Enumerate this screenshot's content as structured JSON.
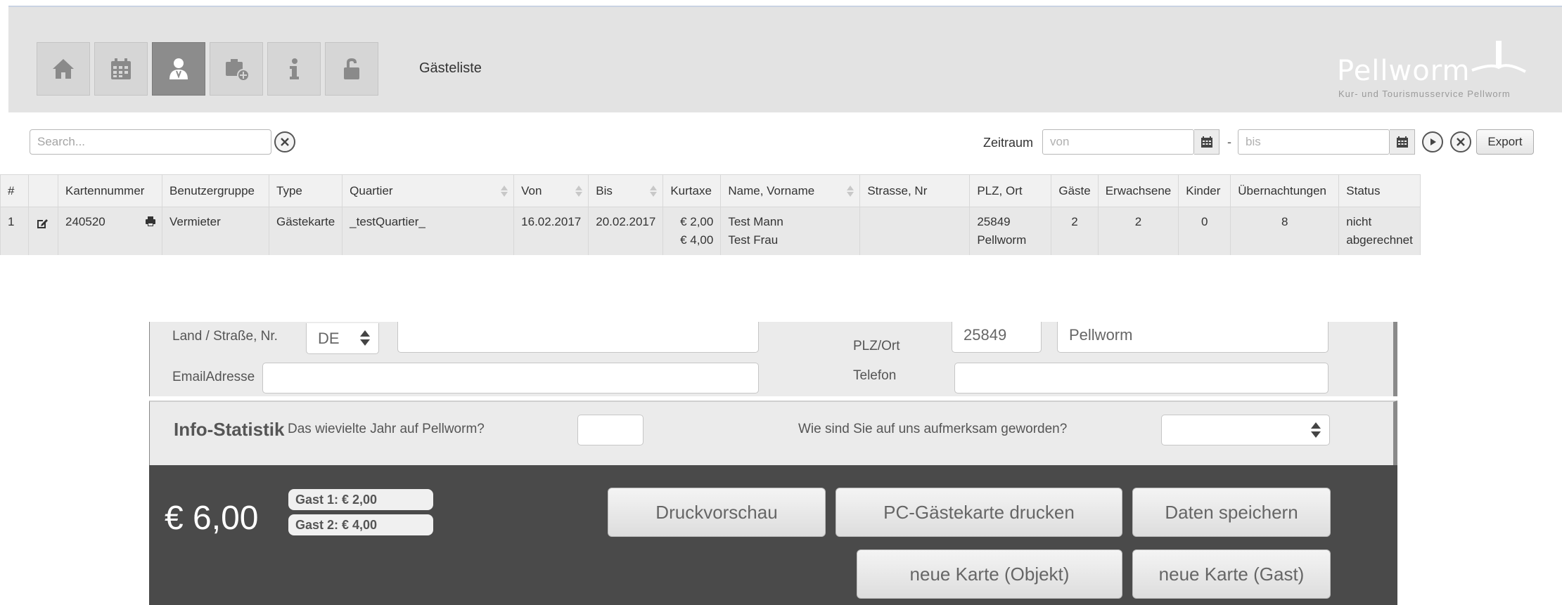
{
  "header": {
    "page_title": "Gästeliste",
    "logo_name": "Pellworm",
    "logo_subtitle": "Kur- und Tourismusservice Pellworm",
    "nav": [
      {
        "icon": "home-icon",
        "active": false
      },
      {
        "icon": "calendar-icon",
        "active": false
      },
      {
        "icon": "guest-user-icon",
        "active": true
      },
      {
        "icon": "add-card-icon",
        "active": false
      },
      {
        "icon": "info-icon",
        "active": false
      },
      {
        "icon": "unlock-icon",
        "active": false
      }
    ]
  },
  "toolbar": {
    "search_placeholder": "Search...",
    "zeitraum_label": "Zeitraum",
    "von_placeholder": "von",
    "date_separator": "-",
    "bis_placeholder": "bis",
    "export_label": "Export"
  },
  "table": {
    "columns": [
      "#",
      "",
      "Kartennummer",
      "Benutzergruppe",
      "Type",
      "Quartier",
      "Von",
      "Bis",
      "Kurtaxe",
      "Name, Vorname",
      "Strasse, Nr",
      "PLZ, Ort",
      "Gäste",
      "Erwachsene",
      "Kinder",
      "Übernachtungen",
      "Status"
    ],
    "rows": [
      {
        "index": "1",
        "kartennummer": "240520",
        "benutzergruppe": "Vermieter",
        "type": "Gästekarte",
        "quartier": "_testQuartier_",
        "von": "16.02.2017",
        "bis": "20.02.2017",
        "kurtaxe_1": "€ 2,00",
        "kurtaxe_2": "€ 4,00",
        "name_1": "Test Mann",
        "name_2": "Test Frau",
        "strasse": "",
        "plz": "25849",
        "ort": "Pellworm",
        "gaeste": "2",
        "erwachsene": "2",
        "kinder": "0",
        "uebernachtungen": "8",
        "status_1": "nicht",
        "status_2": "abgerechnet"
      }
    ]
  },
  "form": {
    "land_label": "Land / Straße, Nr.",
    "land_value": "DE",
    "strasse_value": "",
    "plzort_label": "PLZ/Ort",
    "plz_value": "25849",
    "ort_value": "Pellworm",
    "email_label": "EmailAdresse",
    "email_value": "",
    "telefon_label": "Telefon",
    "telefon_value": "",
    "info_title": "Info-Statistik",
    "jahr_question": "Das wievielte Jahr auf Pellworm?",
    "jahr_value": "",
    "aufmerksam_question": "Wie sind Sie auf uns aufmerksam geworden?",
    "aufmerksam_value": ""
  },
  "summary": {
    "total": "€ 6,00",
    "gast1": "Gast 1: € 2,00",
    "gast2": "Gast 2: € 4,00",
    "buttons": {
      "druckvorschau": "Druckvorschau",
      "pc_karte": "PC-Gästekarte drucken",
      "speichern": "Daten speichern",
      "neue_objekt": "neue Karte (Objekt)",
      "neue_gast": "neue Karte (Gast)"
    }
  },
  "colors": {
    "header_bg": "#e3e3e3",
    "active_nav": "#8c8c8c",
    "dark_panel": "#4a4a4a"
  }
}
